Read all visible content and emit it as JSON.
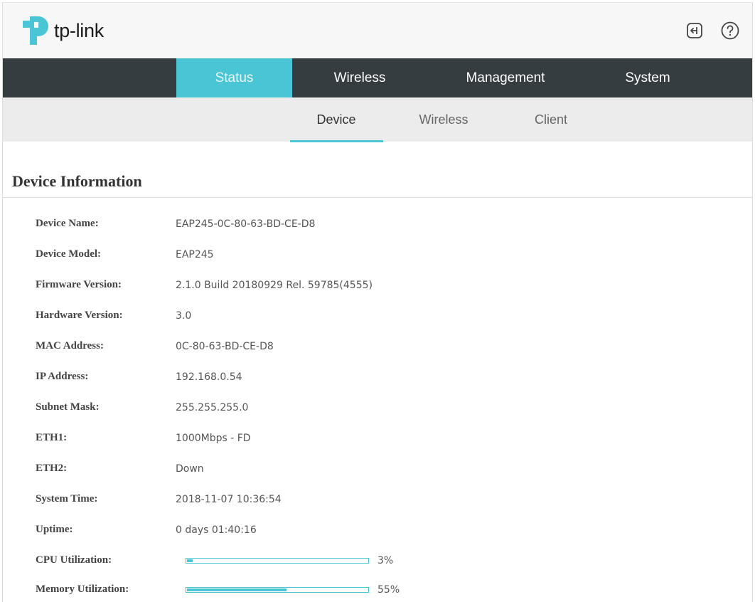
{
  "brand": {
    "name": "tp-link",
    "accent": "#4ac5d6",
    "nav_bg": "#353d40"
  },
  "header": {
    "icons": [
      {
        "name": "logout-icon"
      },
      {
        "name": "help-icon"
      }
    ]
  },
  "main_nav": {
    "tabs": [
      {
        "label": "Status",
        "active": true
      },
      {
        "label": "Wireless",
        "active": false
      },
      {
        "label": "Management",
        "active": false
      },
      {
        "label": "System",
        "active": false
      }
    ]
  },
  "sub_nav": {
    "tabs": [
      {
        "label": "Device",
        "active": true
      },
      {
        "label": "Wireless",
        "active": false
      },
      {
        "label": "Client",
        "active": false
      }
    ]
  },
  "section": {
    "title": "Device Information",
    "rows": [
      {
        "label": "Device Name:",
        "value": "EAP245-0C-80-63-BD-CE-D8"
      },
      {
        "label": "Device Model:",
        "value": "EAP245"
      },
      {
        "label": "Firmware Version:",
        "value": "2.1.0 Build 20180929 Rel. 59785(4555)"
      },
      {
        "label": "Hardware Version:",
        "value": "3.0"
      },
      {
        "label": "MAC Address:",
        "value": "0C-80-63-BD-CE-D8"
      },
      {
        "label": "IP Address:",
        "value": "192.168.0.54"
      },
      {
        "label": "Subnet Mask:",
        "value": "255.255.255.0"
      },
      {
        "label": "ETH1:",
        "value": "1000Mbps - FD"
      },
      {
        "label": "ETH2:",
        "value": "Down"
      },
      {
        "label": "System Time:",
        "value": "2018-11-07 10:36:54"
      },
      {
        "label": "Uptime:",
        "value": "0 days 01:40:16"
      }
    ],
    "utilization": [
      {
        "label": "CPU Utilization:",
        "percent": 3,
        "text": "3%"
      },
      {
        "label": "Memory Utilization:",
        "percent": 55,
        "text": "55%"
      }
    ]
  }
}
